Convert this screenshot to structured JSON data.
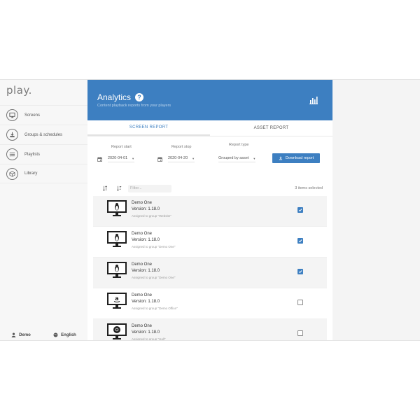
{
  "app": {
    "logo": "play."
  },
  "sidebar": {
    "items": [
      {
        "label": "Screens",
        "icon": "monitor-icon"
      },
      {
        "label": "Groups & schedules",
        "icon": "download-icon"
      },
      {
        "label": "Playlists",
        "icon": "list-icon"
      },
      {
        "label": "Library",
        "icon": "box-icon"
      }
    ],
    "footer": {
      "user": "Demo",
      "language": "English"
    }
  },
  "header": {
    "title": "Analytics",
    "subtitle": "Content playback reports from your players",
    "help": "?"
  },
  "tabs": [
    {
      "label": "SCREEN REPORT",
      "active": true
    },
    {
      "label": "ASSET REPORT",
      "active": false
    }
  ],
  "controls": {
    "report_start_label": "Report start",
    "report_start_value": "2020-04-01",
    "report_stop_label": "Report stop",
    "report_stop_value": "2020-04-20",
    "report_type_label": "Report type",
    "report_type_value": "Grouped by asset",
    "download_label": "Download report"
  },
  "list_toolbar": {
    "filter_placeholder": "Filter...",
    "selected_count": "3 items selected"
  },
  "players": [
    {
      "name": "Demo One",
      "version": "Version: 1.18.0",
      "group": "Assigned to group \"Website\"",
      "os": "linux",
      "checked": true
    },
    {
      "name": "Demo One",
      "version": "Version: 1.18.0",
      "group": "Assigned to group \"Demo One\"",
      "os": "linux",
      "checked": true
    },
    {
      "name": "Demo One",
      "version": "Version: 1.18.0",
      "group": "Assigned to group \"Demo One\"",
      "os": "linux",
      "checked": true
    },
    {
      "name": "Demo One",
      "version": "Version: 1.18.0",
      "group": "Assigned to group \"Demo Office\"",
      "os": "amazon",
      "checked": false
    },
    {
      "name": "Demo One",
      "version": "Version: 1.18.0",
      "group": "Assigned to group \"Hall\"",
      "os": "chrome",
      "checked": false
    }
  ],
  "colors": {
    "accent": "#3d7fc1",
    "sidebar_bg": "#f7f7f7"
  }
}
